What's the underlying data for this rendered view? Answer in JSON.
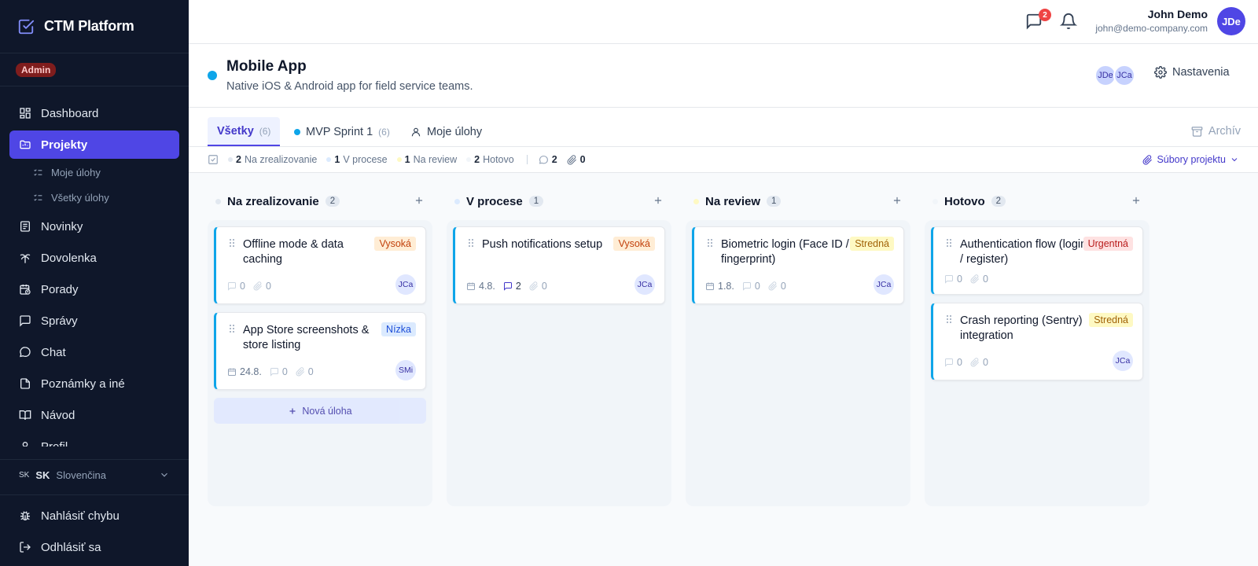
{
  "app": {
    "title": "CTM Platform",
    "role": "Admin"
  },
  "sidebar": {
    "items": [
      {
        "label": "Dashboard",
        "icon": "dashboard-icon"
      },
      {
        "label": "Projekty",
        "icon": "folder-icon",
        "active": true
      },
      {
        "label": "Novinky",
        "icon": "news-icon"
      },
      {
        "label": "Dovolenka",
        "icon": "palm-icon"
      },
      {
        "label": "Porady",
        "icon": "calendar-clock-icon"
      },
      {
        "label": "Správy",
        "icon": "message-icon"
      },
      {
        "label": "Chat",
        "icon": "chat-icon"
      },
      {
        "label": "Poznámky a iné",
        "icon": "note-icon"
      },
      {
        "label": "Návod",
        "icon": "book-icon"
      },
      {
        "label": "Profil",
        "icon": "user-icon"
      }
    ],
    "subitems": [
      {
        "label": "Moje úlohy"
      },
      {
        "label": "Všetky úlohy"
      }
    ],
    "language": {
      "flag": "SK",
      "code": "SK",
      "name": "Slovenčina"
    },
    "report_bug": "Nahlásiť chybu",
    "logout": "Odhlásiť sa"
  },
  "topbar": {
    "messages_badge": "2",
    "user": {
      "name": "John Demo",
      "email": "john@demo-company.com",
      "initials": "JDe"
    }
  },
  "project": {
    "title": "Mobile App",
    "description": "Native iOS & Android app for field service teams.",
    "members": [
      "JDe",
      "JCa"
    ],
    "settings_label": "Nastavenia",
    "color": "#0ea5e9"
  },
  "tabs": {
    "all": {
      "label": "Všetky",
      "count": "(6)"
    },
    "sprint": {
      "label": "MVP Sprint 1",
      "count": "(6)"
    },
    "mine": {
      "label": "Moje úlohy"
    },
    "archive": "Archív"
  },
  "stats": {
    "todo": {
      "value": "2",
      "label": "Na zrealizovanie"
    },
    "progress": {
      "value": "1",
      "label": "V procese"
    },
    "review": {
      "value": "1",
      "label": "Na review"
    },
    "done": {
      "value": "2",
      "label": "Hotovo"
    },
    "comments": "2",
    "attachments": "0",
    "files_label": "Súbory projektu"
  },
  "columns": [
    {
      "title": "Na zrealizovanie",
      "count": "2",
      "cards": [
        {
          "title": "Offline mode & data caching",
          "priority": "Vysoká",
          "comments": "0",
          "attachments": "0",
          "assignee": "JCa"
        },
        {
          "title": "App Store screenshots & store listing",
          "priority": "Nízka",
          "date": "24.8.",
          "comments": "0",
          "attachments": "0",
          "assignee": "SMi"
        }
      ],
      "new_task": "Nová úloha"
    },
    {
      "title": "V procese",
      "count": "1",
      "cards": [
        {
          "title": "Push notifications setup",
          "priority": "Vysoká",
          "date": "4.8.",
          "comments": "2",
          "attachments": "0",
          "assignee": "JCa"
        }
      ]
    },
    {
      "title": "Na review",
      "count": "1",
      "cards": [
        {
          "title": "Biometric login (Face ID / fingerprint)",
          "priority": "Stredná",
          "date": "1.8.",
          "comments": "0",
          "attachments": "0",
          "assignee": "JCa"
        }
      ]
    },
    {
      "title": "Hotovo",
      "count": "2",
      "cards": [
        {
          "title": "Authentication flow (login / register)",
          "priority": "Urgentná",
          "comments": "0",
          "attachments": "0"
        },
        {
          "title": "Crash reporting (Sentry) integration",
          "priority": "Stredná",
          "comments": "0",
          "attachments": "0",
          "assignee": "JCa"
        }
      ]
    }
  ],
  "colors": {
    "accent": "#4f46e5",
    "sidebar_bg": "#0f172a",
    "card_border": "#0ea5e9",
    "badge_red": "#ef4444"
  }
}
